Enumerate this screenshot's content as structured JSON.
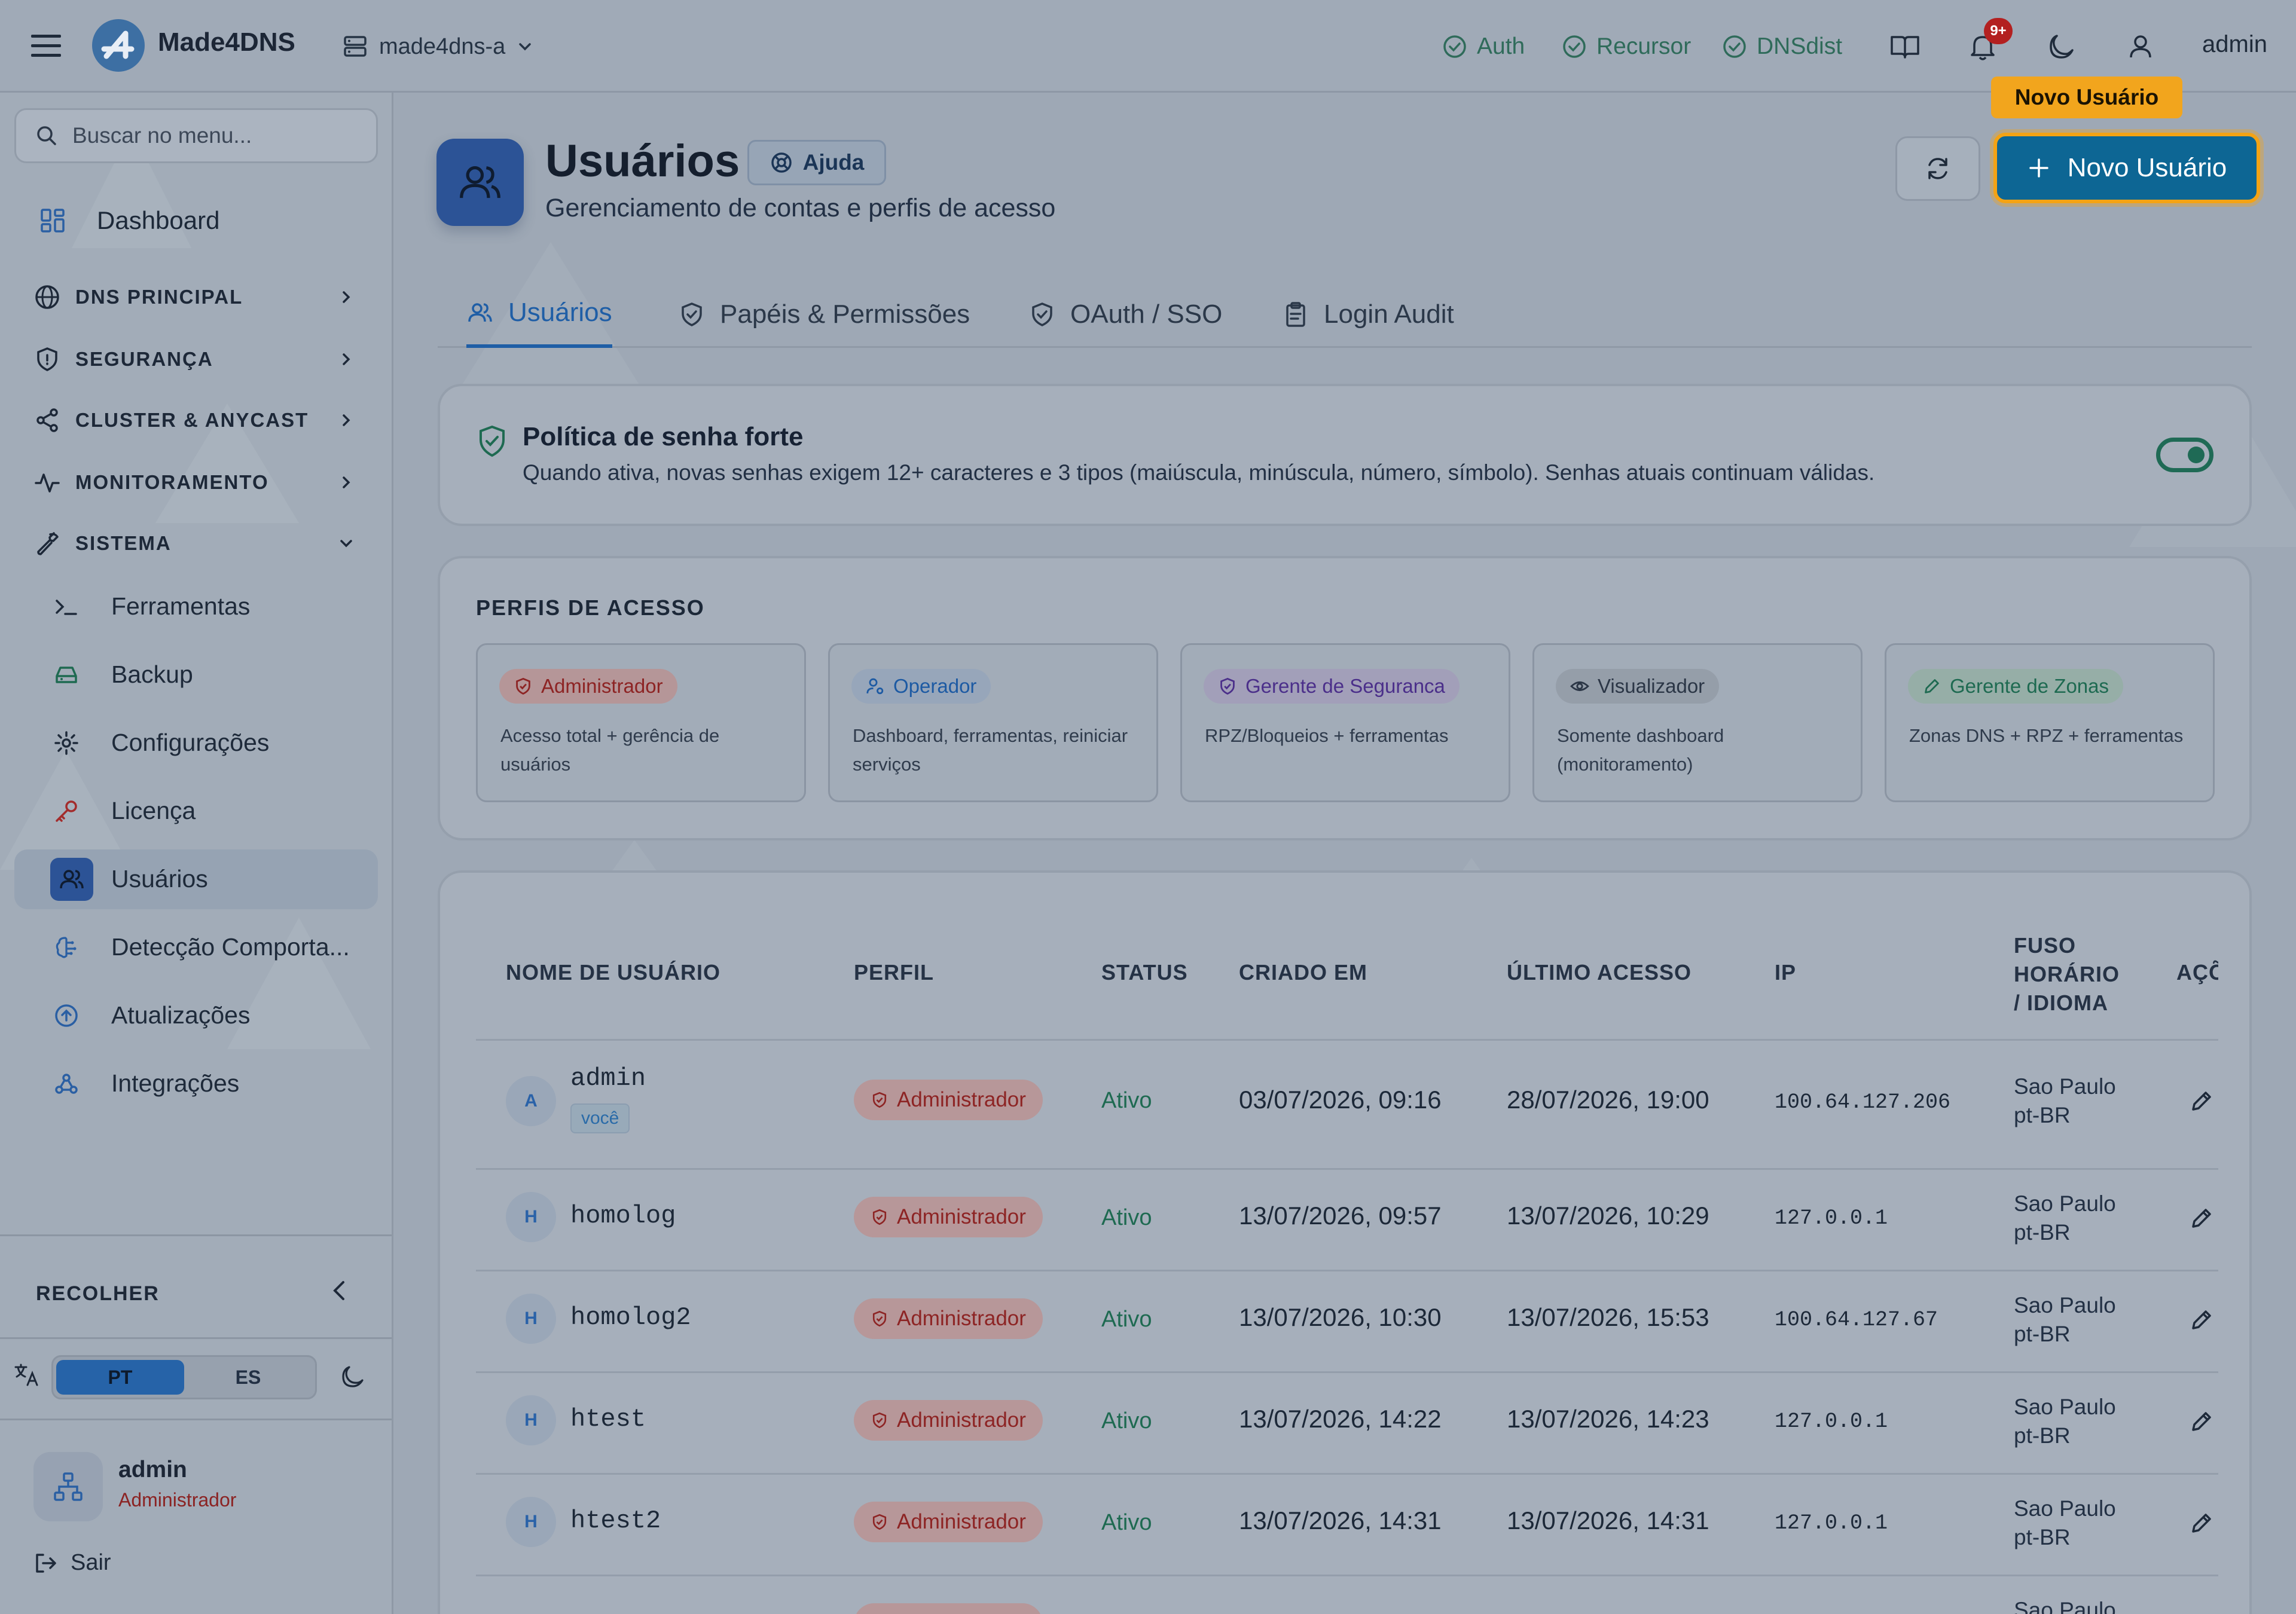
{
  "app": {
    "brand": "Made4DNS",
    "server": "made4dns-a",
    "notif_count": "9+",
    "user": "admin",
    "services": [
      "Auth",
      "Recursor",
      "DNSdist"
    ]
  },
  "sidebar": {
    "search_placeholder": "Buscar no menu...",
    "dashboard": "Dashboard",
    "sections": [
      "DNS PRINCIPAL",
      "SEGURANÇA",
      "CLUSTER & ANYCAST",
      "MONITORAMENTO",
      "SISTEMA"
    ],
    "items": [
      "Ferramentas",
      "Backup",
      "Configurações",
      "Licença",
      "Usuários",
      "Detecção Comporta...",
      "Atualizações",
      "Integrações"
    ],
    "collapse": "RECOLHER",
    "lang": [
      "PT",
      "ES"
    ],
    "user_name": "admin",
    "user_role": "Administrador",
    "logout": "Sair"
  },
  "page": {
    "title": "Usuários",
    "help": "Ajuda",
    "subtitle": "Gerenciamento de contas e perfis de acesso",
    "new_user": "Novo Usuário",
    "tooltip": "Novo Usuário",
    "tabs": [
      "Usuários",
      "Papéis & Permissões",
      "OAuth / SSO",
      "Login Audit"
    ]
  },
  "policy": {
    "title": "Política de senha forte",
    "desc": "Quando ativa, novas senhas exigem 12+ caracteres e 3 tipos (maiúscula, minúscula, número, símbolo). Senhas atuais continuam válidas.",
    "enabled": true
  },
  "profiles": {
    "heading": "PERFIS DE ACESSO",
    "items": [
      {
        "name": "Administrador",
        "desc": "Acesso total + gerência de usuários"
      },
      {
        "name": "Operador",
        "desc": "Dashboard, ferramentas, reiniciar serviços"
      },
      {
        "name": "Gerente de Seguranca",
        "desc": "RPZ/Bloqueios + ferramentas"
      },
      {
        "name": "Visualizador",
        "desc": "Somente dashboard (monitoramento)"
      },
      {
        "name": "Gerente de Zonas",
        "desc": "Zonas DNS + RPZ + ferramentas"
      }
    ]
  },
  "table": {
    "headers": [
      "NOME DE USUÁRIO",
      "PERFIL",
      "STATUS",
      "CRIADO EM",
      "ÚLTIMO ACESSO",
      "IP",
      "FUSO",
      "HORÁRIO",
      "/ IDIOMA",
      "AÇÕ"
    ],
    "you_label": "você",
    "rows": [
      {
        "initial": "A",
        "user": "admin",
        "role": "Administrador",
        "status": "Ativo",
        "created": "03/07/2026, 09:16",
        "last": "28/07/2026, 19:00",
        "ip": "100.64.127.206",
        "tz": "Sao Paulo",
        "lang": "pt-BR"
      },
      {
        "initial": "H",
        "user": "homolog",
        "role": "Administrador",
        "status": "Ativo",
        "created": "13/07/2026, 09:57",
        "last": "13/07/2026, 10:29",
        "ip": "127.0.0.1",
        "tz": "Sao Paulo",
        "lang": "pt-BR"
      },
      {
        "initial": "H",
        "user": "homolog2",
        "role": "Administrador",
        "status": "Ativo",
        "created": "13/07/2026, 10:30",
        "last": "13/07/2026, 15:53",
        "ip": "100.64.127.67",
        "tz": "Sao Paulo",
        "lang": "pt-BR"
      },
      {
        "initial": "H",
        "user": "htest",
        "role": "Administrador",
        "status": "Ativo",
        "created": "13/07/2026, 14:22",
        "last": "13/07/2026, 14:23",
        "ip": "127.0.0.1",
        "tz": "Sao Paulo",
        "lang": "pt-BR"
      },
      {
        "initial": "H",
        "user": "htest2",
        "role": "Administrador",
        "status": "Ativo",
        "created": "13/07/2026, 14:31",
        "last": "13/07/2026, 14:31",
        "ip": "127.0.0.1",
        "tz": "Sao Paulo",
        "lang": "pt-BR"
      },
      {
        "initial": "",
        "user": "",
        "role": "",
        "status": "",
        "created": "",
        "last": "",
        "ip": "",
        "tz": "Sao Paulo",
        "lang": ""
      }
    ]
  },
  "colors": {
    "accent": "#0d6694",
    "highlight": "#f4a314",
    "active_green": "#1e6a51",
    "admin_red": "#8d2424"
  }
}
